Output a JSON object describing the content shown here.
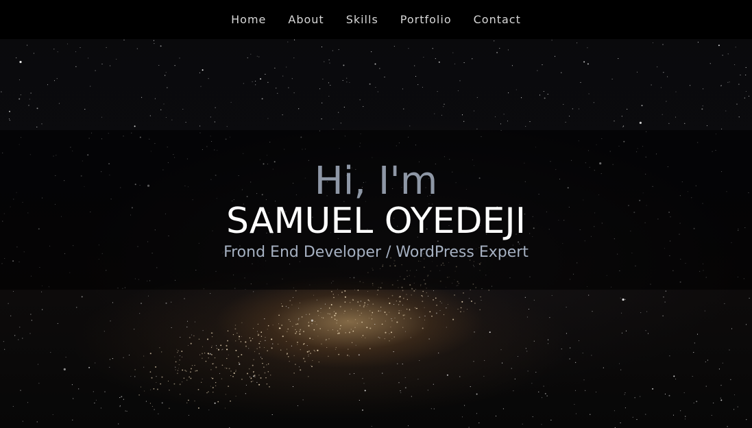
{
  "nav": {
    "items": [
      {
        "label": "Home"
      },
      {
        "label": "About"
      },
      {
        "label": "Skills"
      },
      {
        "label": "Portfolio"
      },
      {
        "label": "Contact"
      }
    ]
  },
  "hero": {
    "greeting": "Hi, I'm",
    "name": "SAMUEL OYEDEJI",
    "role": "Frond End Developer / WordPress Expert"
  },
  "colors": {
    "nav_background": "#000000",
    "nav_text": "#d8d8d8",
    "greeting_text": "#8e97a6",
    "name_text": "#ffffff",
    "role_text": "#a6b1c2"
  }
}
